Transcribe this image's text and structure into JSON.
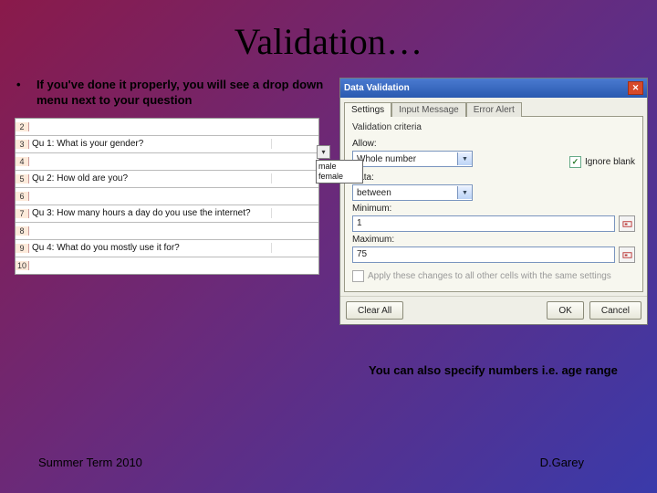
{
  "title": "Validation…",
  "bullet": "If you've done it properly, you will see a drop down menu next to your question",
  "sheet": {
    "rows": [
      {
        "n": "2",
        "a": ""
      },
      {
        "n": "3",
        "a": "Qu 1: What is your gender?"
      },
      {
        "n": "4",
        "a": ""
      },
      {
        "n": "5",
        "a": "Qu 2: How old are you?"
      },
      {
        "n": "6",
        "a": ""
      },
      {
        "n": "7",
        "a": "Qu 3: How many hours a day do you use the internet?"
      },
      {
        "n": "8",
        "a": ""
      },
      {
        "n": "9",
        "a": "Qu 4: What do you mostly use it for?"
      },
      {
        "n": "10",
        "a": ""
      }
    ],
    "dropdown": {
      "opt1": "male",
      "opt2": "female"
    }
  },
  "dialog": {
    "title": "Data Validation",
    "tabs": {
      "t1": "Settings",
      "t2": "Input Message",
      "t3": "Error Alert"
    },
    "criteria": "Validation criteria",
    "allowLbl": "Allow:",
    "allowVal": "Whole number",
    "ignore": "Ignore blank",
    "dataLbl": "Data:",
    "dataVal": "between",
    "minLbl": "Minimum:",
    "minVal": "1",
    "maxLbl": "Maximum:",
    "maxVal": "75",
    "apply": "Apply these changes to all other cells with the same settings",
    "clear": "Clear All",
    "ok": "OK",
    "cancel": "Cancel"
  },
  "caption": "You can also specify numbers i.e. age range",
  "footer": {
    "left": "Summer Term 2010",
    "right": "D.Garey"
  }
}
